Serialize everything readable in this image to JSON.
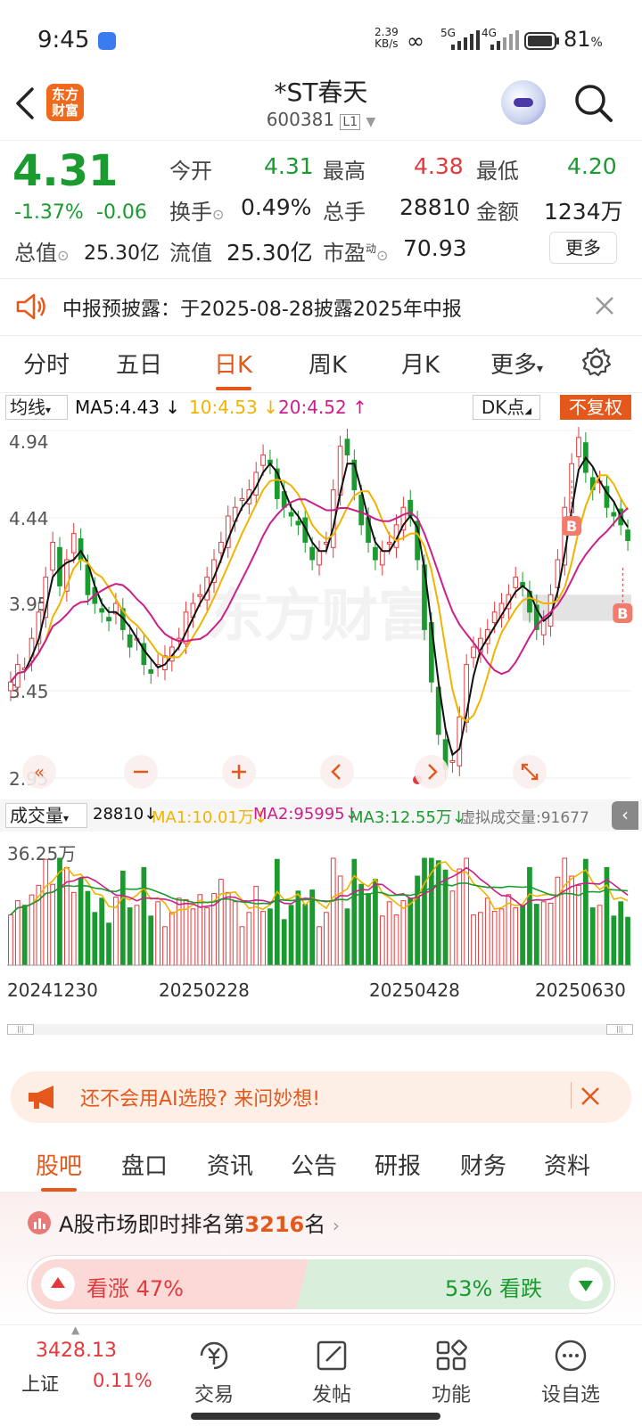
{
  "status_bar": {
    "time": "9:45",
    "net_speed_top": "2.39",
    "net_speed_bottom": "KB/s",
    "signal_5g": "5G",
    "signal_4g": "4G",
    "battery": "81",
    "battery_unit": "%"
  },
  "header": {
    "logo_line1": "东方",
    "logo_line2": "财富",
    "title": "*ST春天",
    "code": "600381",
    "level_badge": "L1"
  },
  "quote": {
    "price": "4.31",
    "change_pct": "-1.37%",
    "change": "-0.06",
    "open_label": "今开",
    "open": "4.31",
    "high_label": "最高",
    "high": "4.38",
    "low_label": "最低",
    "low": "4.20",
    "turnover_label": "换手",
    "turnover": "0.49%",
    "volume_label": "总手",
    "volume": "28810",
    "amount_label": "金额",
    "amount": "1234万",
    "mktcap_label": "总值",
    "mktcap": "25.30亿",
    "float_label": "流值",
    "float": "25.30亿",
    "pe_label": "市盈",
    "pe_sup": "动",
    "pe": "70.93",
    "more_button": "更多"
  },
  "notice": {
    "text": "中报预披露：于2025-08-28披露2025年中报"
  },
  "chart_tabs": [
    "分时",
    "五日",
    "日K",
    "周K",
    "月K",
    "更多"
  ],
  "chart_tabs_active": 2,
  "ma_bar": {
    "selector": "均线",
    "ma5": "MA5:4.43",
    "ma10": "10:4.53",
    "ma20": "20:4.52",
    "dk_button": "DK点",
    "fq_button": "不复权"
  },
  "vol_bar": {
    "selector": "成交量",
    "vol": "28810",
    "ma1": "MA1:10.01万",
    "ma2": "MA2:95995",
    "ma3": "MA3:12.55万",
    "virtual": "虚拟成交量:91677"
  },
  "colors": {
    "up": "#e4393c",
    "down": "#1a9a2f",
    "ma5": "#111111",
    "ma10": "#f0b400",
    "ma20": "#cc1f8a",
    "accent": "#e4581c"
  },
  "chart_data": {
    "type": "candlestick",
    "y_ticks": [
      "4.94",
      "4.44",
      "3.95",
      "3.45",
      "2.95"
    ],
    "ylim": [
      2.95,
      4.94
    ],
    "vol_max_label": "36.25万",
    "x_ticks": [
      "20241230",
      "20250228",
      "20250428",
      "20250630"
    ],
    "closes": [
      3.5,
      3.6,
      3.58,
      3.75,
      3.9,
      4.1,
      4.3,
      4.05,
      4.2,
      4.35,
      4.2,
      4.0,
      3.95,
      3.9,
      3.85,
      3.95,
      3.8,
      3.7,
      3.75,
      3.6,
      3.55,
      3.6,
      3.65,
      3.7,
      3.75,
      3.9,
      3.95,
      4.0,
      4.1,
      4.2,
      4.3,
      4.45,
      4.5,
      4.55,
      4.6,
      4.7,
      4.8,
      4.75,
      4.55,
      4.5,
      4.45,
      4.4,
      4.3,
      4.2,
      4.25,
      4.3,
      4.6,
      4.85,
      4.8,
      4.6,
      4.4,
      4.3,
      4.2,
      4.25,
      4.3,
      4.4,
      4.5,
      4.45,
      4.2,
      3.8,
      3.5,
      3.2,
      3.0,
      3.05,
      3.3,
      3.6,
      3.7,
      3.75,
      3.8,
      3.9,
      3.95,
      4.0,
      4.1,
      4.05,
      3.9,
      3.8,
      3.85,
      4.0,
      4.2,
      4.5,
      4.75,
      4.9,
      4.7,
      4.6,
      4.65,
      4.5,
      4.45,
      4.4,
      4.31
    ],
    "volume_max": 36.25,
    "ma_labels": [
      "MA5",
      "10",
      "20"
    ],
    "markers": [
      "B",
      "B"
    ]
  },
  "ai_bar": {
    "text": "还不会用AI选股? 来问妙想!"
  },
  "content_tabs": [
    "股吧",
    "盘口",
    "资讯",
    "公告",
    "研报",
    "财务",
    "资料"
  ],
  "content_tabs_active": 0,
  "rank": {
    "prefix": "A股市场即时排名第",
    "number": "3216",
    "suffix": "名",
    "up_label": "看涨 47%",
    "down_label": "53% 看跌",
    "up_pct": 47
  },
  "bottom_nav": {
    "index_value": "3428.13",
    "index_name": "上证",
    "index_change": "0.11%",
    "items": [
      "交易",
      "发帖",
      "功能",
      "设自选"
    ]
  }
}
